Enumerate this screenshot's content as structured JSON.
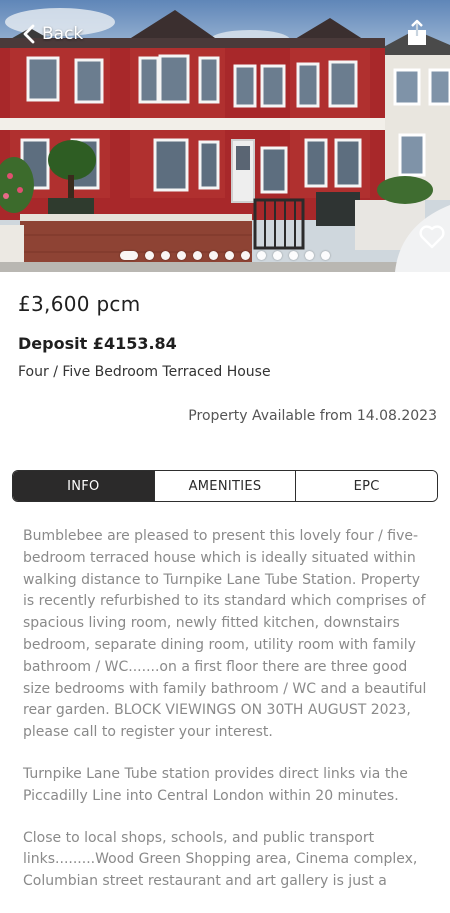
{
  "nav": {
    "back_label": "Back",
    "share_icon": "share-icon",
    "back_icon": "chevron-left-icon",
    "favorite_icon": "heart-outline-icon"
  },
  "gallery": {
    "photo_count": 13,
    "active_index": 0,
    "photo_alt": "red brick terraced house exterior"
  },
  "listing": {
    "price": "£3,600 pcm",
    "deposit": "Deposit £4153.84",
    "property_type": "Four / Five Bedroom Terraced House",
    "availability": "Property Available from 14.08.2023"
  },
  "tabs": [
    {
      "label": "INFO",
      "active": true
    },
    {
      "label": "AMENITIES",
      "active": false
    },
    {
      "label": "EPC",
      "active": false
    }
  ],
  "description": {
    "paragraphs": [
      "Bumblebee are pleased to present this lovely four / five-bedroom terraced house which is ideally situated within walking distance to Turnpike Lane Tube Station. Property is recently refurbished to its standard which comprises of spacious living room, newly fitted kitchen, downstairs bedroom, separate dining room, utility room with family bathroom / WC.......on a first floor there are three good size bedrooms with family bathroom / WC and a beautiful rear garden. BLOCK VIEWINGS ON 30TH AUGUST 2023, please call to register your interest.",
      "Turnpike Lane Tube station provides direct links via the Piccadilly Line into Central London within 20 minutes.",
      "Close to local shops, schools, and public transport links.........Wood Green Shopping area, Cinema complex, Columbian street restaurant and art gallery is just a"
    ]
  },
  "colors": {
    "tab_active_bg": "#2b2a2a",
    "text_primary": "#1f1f1f",
    "text_description": "#8a8a8a"
  }
}
